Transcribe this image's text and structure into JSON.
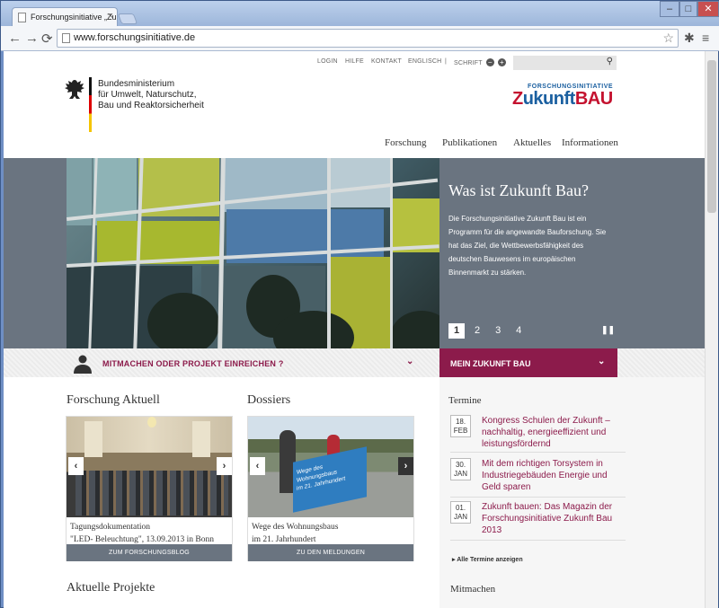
{
  "browser": {
    "tab_title": "Forschungsinitiative „Zuk",
    "url": "www.forschungsinitiative.de"
  },
  "utility": {
    "login": "LOGIN",
    "hilfe": "HILFE",
    "kontakt": "KONTAKT",
    "englisch": "ENGLISCH",
    "sep": "|",
    "schrift": "SCHRIFT"
  },
  "ministry": {
    "line1": "Bundesministerium",
    "line2": "für Umwelt, Naturschutz,",
    "line3": "Bau und Reaktorsicherheit"
  },
  "logo": {
    "top": "FORSCHUNGSINITIATIVE",
    "z": "Z",
    "ukunft": "ukunft",
    "bau": "BAU"
  },
  "mainnav": [
    "Forschung",
    "Publikationen",
    "Aktuelles",
    "Informationen"
  ],
  "hero": {
    "title": "Was ist Zukunft Bau?",
    "body": "Die Forschungsinitiative Zukunft Bau ist ein Programm für die angewandte Bauforschung. Sie hat das Ziel, die Wettbewerbsfähigkeit des deutschen Bauwesens im europäischen Binnenmarkt zu stärken.",
    "pages": [
      "1",
      "2",
      "3",
      "4"
    ]
  },
  "bar": {
    "mitmachen": "MITMACHEN ODER PROJEKT EINREICHEN ?",
    "mein": "MEIN ZUKUNFT BAU"
  },
  "sections": {
    "forschung": "Forschung Aktuell",
    "dossiers": "Dossiers",
    "projekte": "Aktuelle Projekte"
  },
  "cards": [
    {
      "caption1": "Tagungsdokumentation",
      "caption2": "\"LED- Beleuchtung\", 13.09.2013 in Bonn",
      "button": "ZUM FORSCHUNGSBLOG"
    },
    {
      "caption1": "Wege des Wohnungsbaus",
      "caption2": "im 21. Jahrhundert",
      "button": "ZU DEN MELDUNGEN",
      "sign1": "Wege des Wohnungsbaus",
      "sign2": "im 21. Jahrhundert"
    }
  ],
  "termine": {
    "title": "Termine",
    "items": [
      {
        "day": "18.",
        "month": "FEB",
        "text": "Kongress Schulen der Zukunft – nachhaltig, energieeffizient und leistungsfördernd"
      },
      {
        "day": "30.",
        "month": "JAN",
        "text": "Mit dem richtigen Torsystem in Industriegebäuden Energie und Geld sparen"
      },
      {
        "day": "01.",
        "month": "JAN",
        "text": "Zukunft bauen: Das Magazin der Forschungsinitiative Zukunft Bau 2013"
      }
    ],
    "all": "Alle Termine anzeigen"
  },
  "mitmachen_heading": "Mitmachen",
  "colors": {
    "accent": "#8c1b4b",
    "slate": "#6a7480",
    "blue": "#1a5fa0",
    "red": "#c4122f"
  }
}
